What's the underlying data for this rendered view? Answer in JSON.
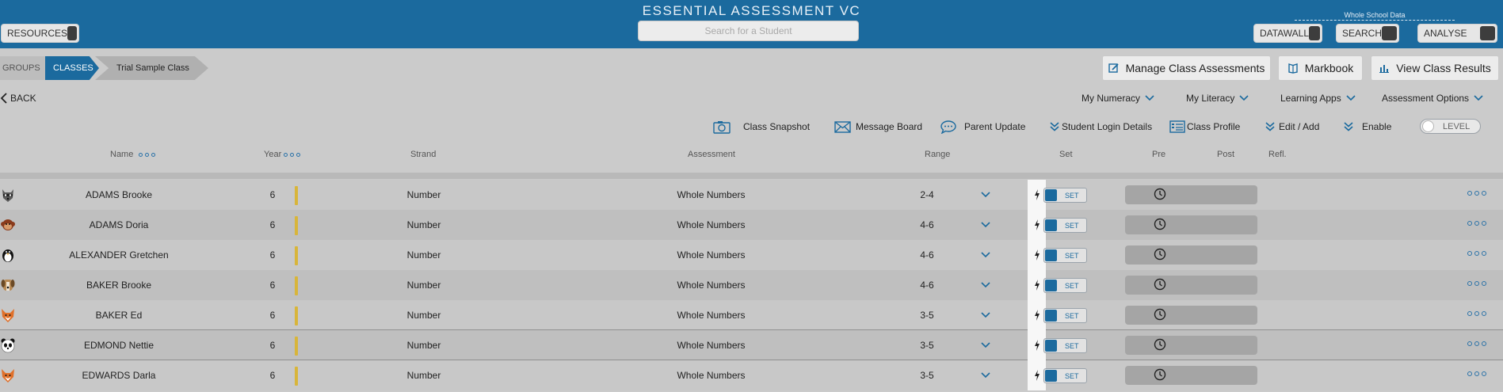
{
  "header": {
    "title": "ESSENTIAL ASSESSMENT VC",
    "resources_label": "RESOURCES",
    "search_placeholder": "Search for a Student",
    "whole_school_label": "Whole School Data",
    "datawall_label": "DATAWALL",
    "search_label": "SEARCH",
    "analyse_label": "ANALYSE",
    "brand_color": "#1b6a9e"
  },
  "breadcrumb": {
    "groups": "GROUPS",
    "classes": "CLASSES",
    "current": "Trial Sample Class"
  },
  "actions": {
    "manage": "Manage Class Assessments",
    "markbook": "Markbook",
    "view_results": "View Class Results"
  },
  "nav": {
    "back": "BACK",
    "menus": [
      "My Numeracy",
      "My Literacy",
      "Learning Apps",
      "Assessment Options"
    ]
  },
  "toolbar": {
    "snapshot": "Class Snapshot",
    "message_board": "Message Board",
    "parent_update": "Parent Update",
    "login_details": "Student Login Details",
    "class_profile": "Class Profile",
    "edit_add": "Edit / Add",
    "enable": "Enable",
    "level": "LEVEL"
  },
  "table": {
    "headers": {
      "name": "Name",
      "year": "Year",
      "strand": "Strand",
      "assessment": "Assessment",
      "range": "Range",
      "set": "Set",
      "pre": "Pre",
      "post": "Post",
      "refl": "Refl."
    },
    "set_label": "SET",
    "rows": [
      {
        "avatar": "raccoon-avatar",
        "name": "ADAMS Brooke",
        "year": "6",
        "strand": "Number",
        "assessment": "Whole Numbers",
        "range": "2-4"
      },
      {
        "avatar": "monkey-avatar",
        "name": "ADAMS Doria",
        "year": "6",
        "strand": "Number",
        "assessment": "Whole Numbers",
        "range": "4-6"
      },
      {
        "avatar": "penguin-avatar",
        "name": "ALEXANDER Gretchen",
        "year": "6",
        "strand": "Number",
        "assessment": "Whole Numbers",
        "range": "4-6"
      },
      {
        "avatar": "dog-avatar",
        "name": "BAKER Brooke",
        "year": "6",
        "strand": "Number",
        "assessment": "Whole Numbers",
        "range": "4-6"
      },
      {
        "avatar": "fox-avatar",
        "name": "BAKER Ed",
        "year": "6",
        "strand": "Number",
        "assessment": "Whole Numbers",
        "range": "3-5"
      },
      {
        "avatar": "panda-avatar",
        "name": "EDMOND Nettie",
        "year": "6",
        "strand": "Number",
        "assessment": "Whole Numbers",
        "range": "3-5"
      },
      {
        "avatar": "fox-avatar",
        "name": "EDWARDS Darla",
        "year": "6",
        "strand": "Number",
        "assessment": "Whole Numbers",
        "range": "3-5"
      }
    ]
  }
}
